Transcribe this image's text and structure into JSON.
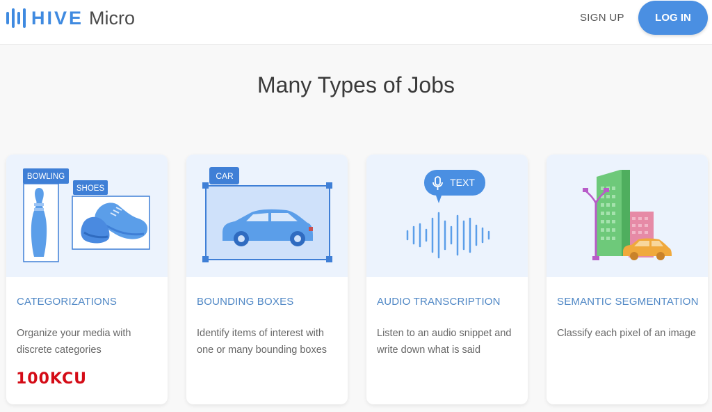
{
  "header": {
    "logo_brand": "HIVE",
    "logo_product": "Micro",
    "signup_label": "SIGN UP",
    "login_label": "LOG IN"
  },
  "main": {
    "heading": "Many Types of Jobs",
    "cards": [
      {
        "title": "CATEGORIZATIONS",
        "description": "Organize your media with discrete categories",
        "tags": [
          "BOWLING",
          "SHOES"
        ]
      },
      {
        "title": "BOUNDING BOXES",
        "description": "Identify items of interest with one or many bounding boxes",
        "tags": [
          "CAR"
        ]
      },
      {
        "title": "AUDIO TRANSCRIPTION",
        "description": "Listen to an audio snippet and write down what is said",
        "tags": [
          "TEXT"
        ]
      },
      {
        "title": "SEMANTIC SEGMENTATION",
        "description": "Classify each pixel of an image",
        "tags": []
      }
    ],
    "badge": "100KCU"
  },
  "colors": {
    "accent": "#3f8ae0",
    "card_title": "#4f87c5",
    "illustration_bg": "#ecf3fd",
    "badge": "#d40b16"
  }
}
